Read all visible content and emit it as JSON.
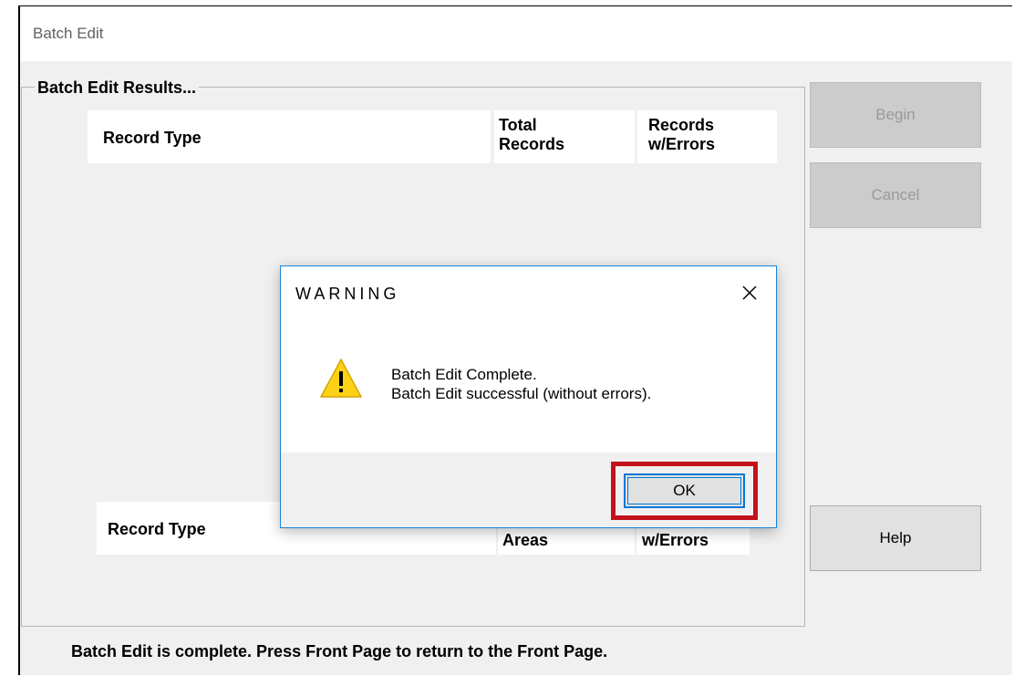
{
  "window": {
    "title": "Batch Edit"
  },
  "group": {
    "label": "Batch Edit Results..."
  },
  "top_table": {
    "record_type": "Record Type",
    "total_records": [
      "Total",
      "Records"
    ],
    "records_errors": [
      "Records",
      "w/Errors"
    ]
  },
  "bottom_table": {
    "record_type": "Record Type",
    "col2": "Areas",
    "col3": "w/Errors"
  },
  "buttons": {
    "begin": "Begin",
    "cancel": "Cancel",
    "help": "Help"
  },
  "status_text": "Batch Edit is complete.  Press Front Page to return to the Front Page.",
  "dialog": {
    "title": "WARNING",
    "message_line1": "Batch Edit Complete.",
    "message_line2": "Batch Edit successful (without errors).",
    "ok_label": "OK",
    "icon": "warning-icon",
    "close_icon": "close-icon"
  },
  "colors": {
    "highlight": "#c4121b",
    "dialog_border": "#1883d7",
    "warning_fill": "#fcd116"
  }
}
